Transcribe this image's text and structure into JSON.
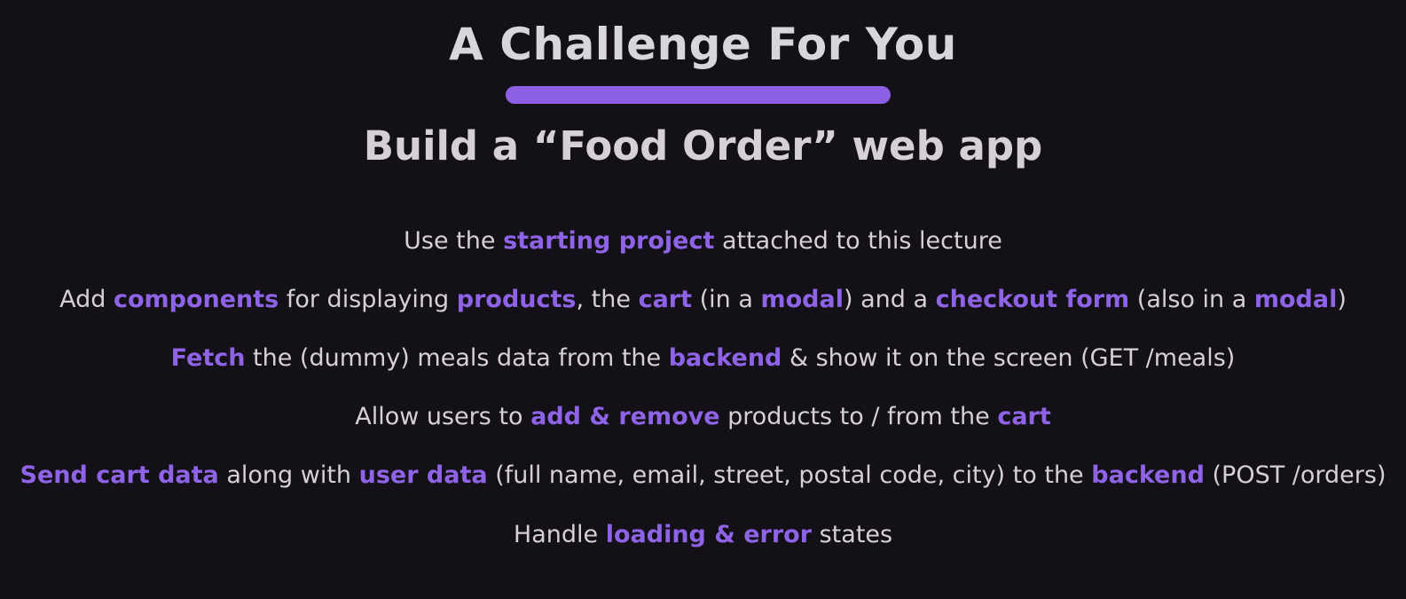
{
  "slide": {
    "title": "A Challenge For You",
    "subtitle": "Build a “Food Order” web app",
    "accent_color": "#8e63e6",
    "background_color": "#131018",
    "bullets": [
      {
        "parts": [
          {
            "text": "Use the ",
            "hl": false
          },
          {
            "text": "starting project",
            "hl": true
          },
          {
            "text": " attached to this lecture",
            "hl": false
          }
        ]
      },
      {
        "parts": [
          {
            "text": "Add ",
            "hl": false
          },
          {
            "text": "components",
            "hl": true
          },
          {
            "text": " for displaying ",
            "hl": false
          },
          {
            "text": "products",
            "hl": true
          },
          {
            "text": ", the ",
            "hl": false
          },
          {
            "text": "cart",
            "hl": true
          },
          {
            "text": " (in a ",
            "hl": false
          },
          {
            "text": "modal",
            "hl": true
          },
          {
            "text": ") and a ",
            "hl": false
          },
          {
            "text": "checkout form",
            "hl": true
          },
          {
            "text": " (also in a ",
            "hl": false
          },
          {
            "text": "modal",
            "hl": true
          },
          {
            "text": ")",
            "hl": false
          }
        ]
      },
      {
        "parts": [
          {
            "text": "Fetch",
            "hl": true
          },
          {
            "text": " the (dummy) meals data from the ",
            "hl": false
          },
          {
            "text": "backend",
            "hl": true
          },
          {
            "text": " & show it on the screen (GET /meals)",
            "hl": false
          }
        ]
      },
      {
        "parts": [
          {
            "text": "Allow users to ",
            "hl": false
          },
          {
            "text": "add & remove",
            "hl": true
          },
          {
            "text": " products to / from the ",
            "hl": false
          },
          {
            "text": "cart",
            "hl": true
          }
        ]
      },
      {
        "parts": [
          {
            "text": "Send cart data",
            "hl": true
          },
          {
            "text": " along with ",
            "hl": false
          },
          {
            "text": "user data",
            "hl": true
          },
          {
            "text": " (full name, email, street, postal code, city) to the ",
            "hl": false
          },
          {
            "text": "backend",
            "hl": true
          },
          {
            "text": " (POST /orders)",
            "hl": false
          }
        ]
      },
      {
        "parts": [
          {
            "text": "Handle ",
            "hl": false
          },
          {
            "text": "loading & error",
            "hl": true
          },
          {
            "text": " states",
            "hl": false
          }
        ]
      }
    ]
  }
}
